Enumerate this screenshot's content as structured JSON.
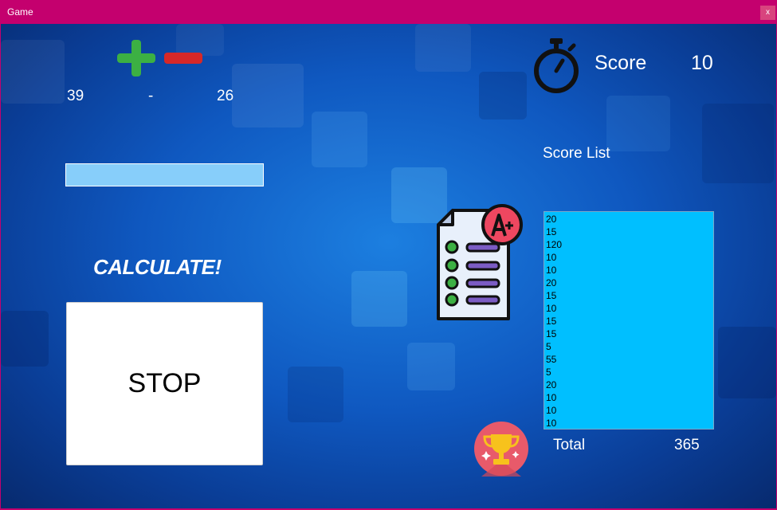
{
  "window": {
    "title": "Game",
    "close_label": "x"
  },
  "operation": {
    "first_number": "39",
    "operator": "-",
    "second_number": "26"
  },
  "answer": {
    "value": ""
  },
  "calculate_label": "CALCULATE!",
  "stop_label": "STOP",
  "score": {
    "label": "Score",
    "value": "10"
  },
  "score_list": {
    "label": "Score List",
    "items": [
      "20",
      "15",
      "120",
      "10",
      "10",
      "20",
      "15",
      "10",
      "15",
      "15",
      "5",
      "55",
      "5",
      "20",
      "10",
      "10",
      "10"
    ]
  },
  "total": {
    "label": "Total",
    "value": "365"
  },
  "icons": {
    "plus": "plus-icon",
    "minus": "minus-icon",
    "stopwatch": "stopwatch-icon",
    "checklist": "grade-checklist-icon",
    "trophy": "trophy-icon"
  },
  "colors": {
    "titlebar": "#c4006e",
    "answer_field": "#87cefa",
    "listbox": "#00bfff",
    "plus": "#3cb043",
    "minus": "#d62828"
  }
}
